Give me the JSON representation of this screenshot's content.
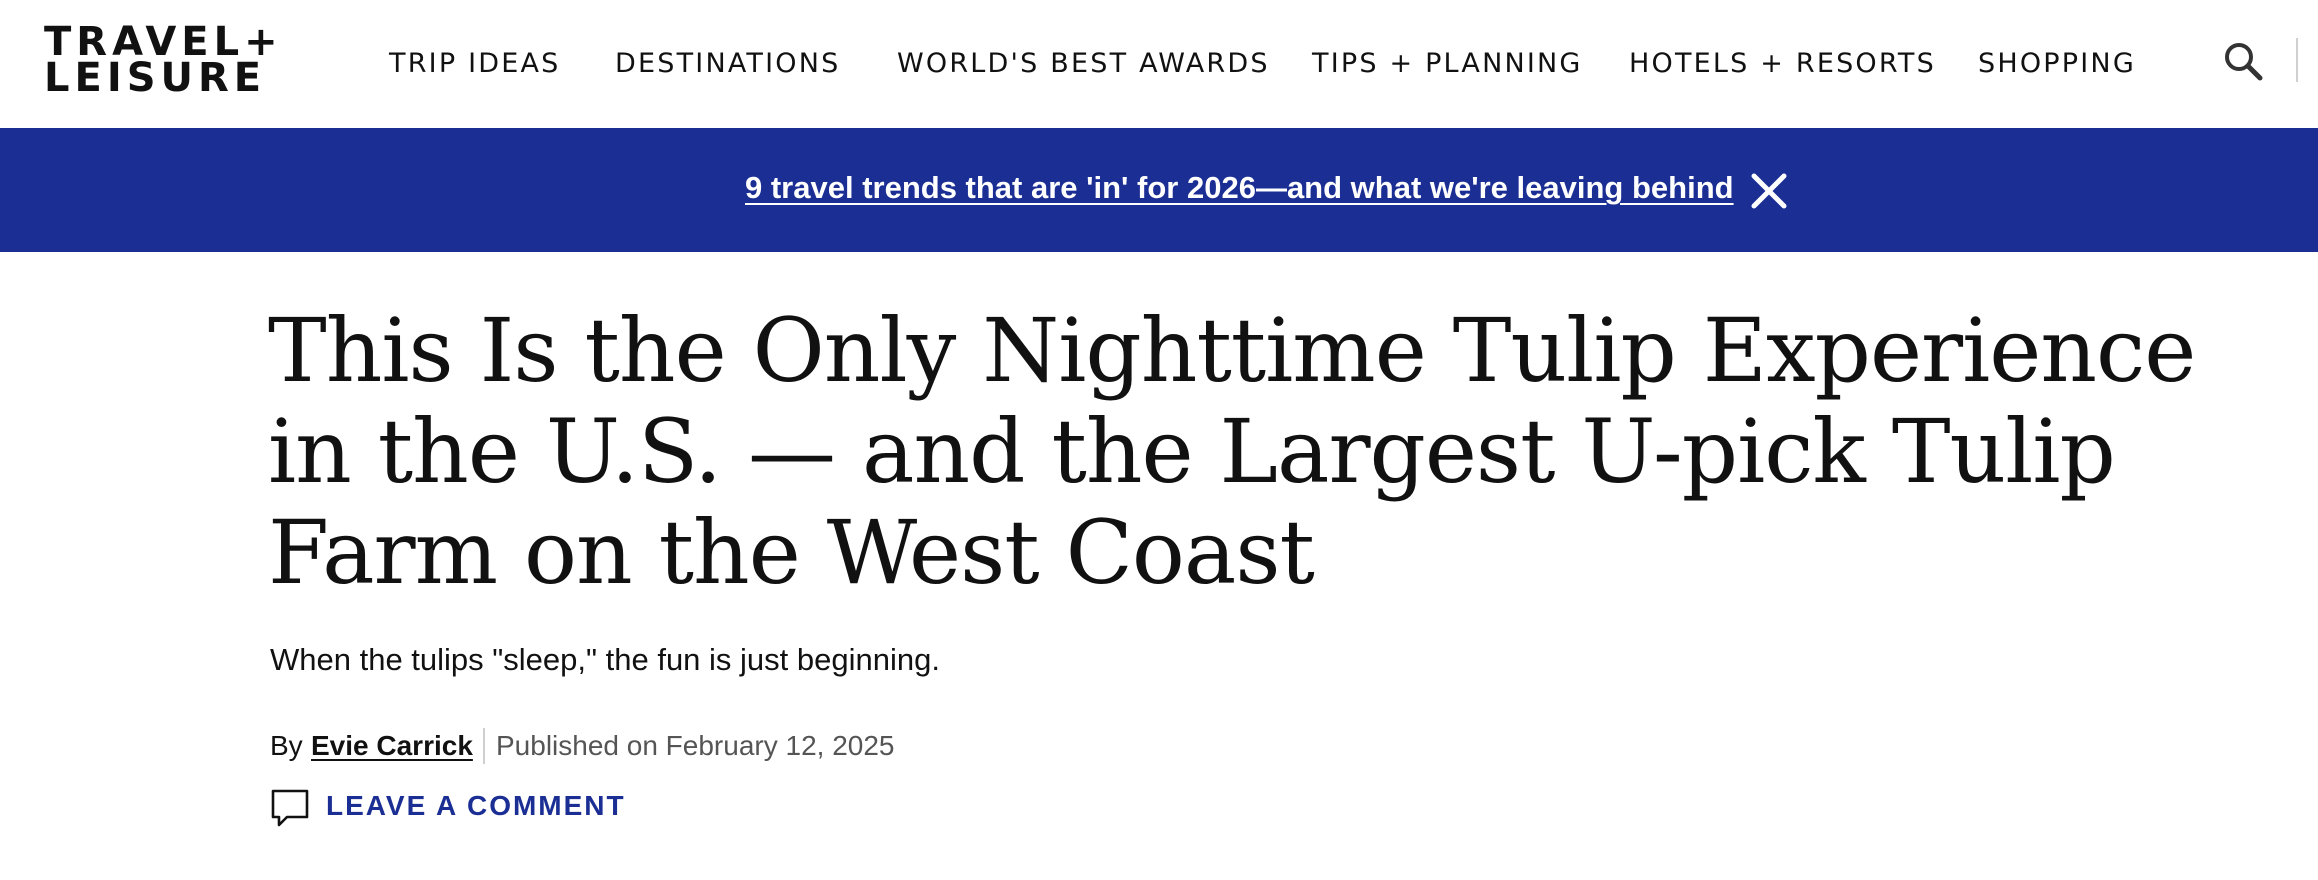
{
  "header": {
    "logo_line1": "TRAVEL+",
    "logo_line2": "LEISURE",
    "nav_items": [
      "TRIP IDEAS",
      "DESTINATIONS",
      "WORLD'S BEST AWARDS",
      "TIPS + PLANNING",
      "HOTELS + RESORTS",
      "SHOPPING"
    ],
    "search_icon": "search-icon"
  },
  "banner": {
    "link_text": "9 travel trends that are 'in' for 2026—and what we're leaving behind",
    "close_icon": "close-icon",
    "background_color": "#1b2e94"
  },
  "article": {
    "headline": "This Is the Only Nighttime Tulip Experience in the U.S. — and the Largest U-pick Tulip Farm on the West Coast",
    "dek": "When the tulips \"sleep,\" the fun is just beginning.",
    "byline_prefix": "By",
    "author": "Evie Carrick",
    "published": "Published on February 12, 2025",
    "comment_label": "LEAVE A COMMENT",
    "comment_icon": "comment-icon",
    "accent_color": "#1b2e94"
  }
}
